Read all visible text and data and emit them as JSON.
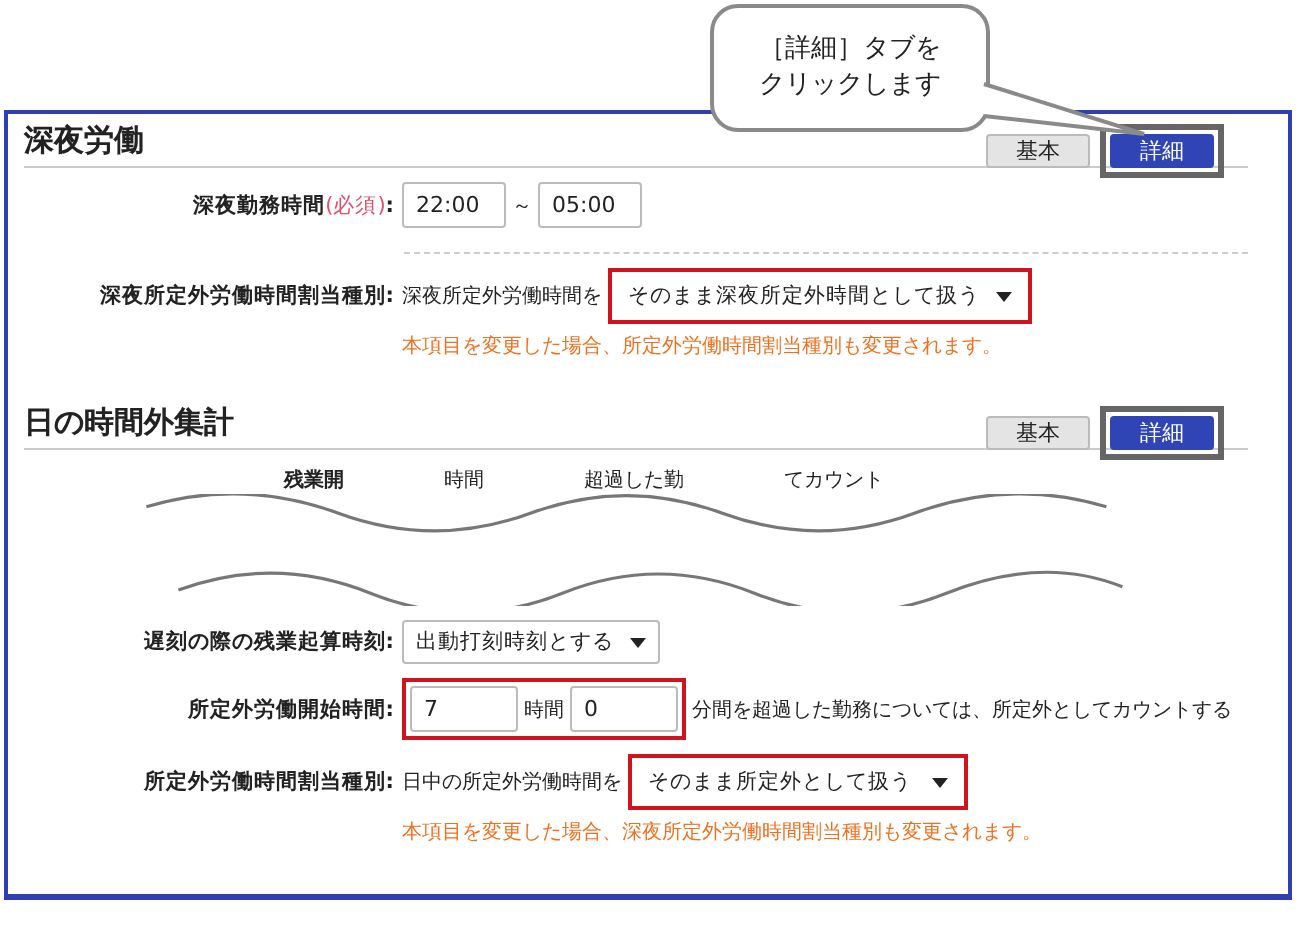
{
  "callout": {
    "lines": [
      "［詳細］タブを",
      "クリックします"
    ]
  },
  "sections": [
    {
      "title": "深夜労働",
      "tabs": [
        {
          "label": "基本",
          "selected": false,
          "highlighted": false
        },
        {
          "label": "詳細",
          "selected": true,
          "highlighted": true
        }
      ],
      "rows": [
        {
          "kind": "time_range",
          "label": "深夜勤務時間",
          "required_mark": "(必須)",
          "label_end": ":",
          "from": "22:00",
          "separator": "～",
          "to": "05:00"
        },
        {
          "kind": "select",
          "label": "深夜所定外労働時間割当種別:",
          "prefix": "深夜所定外労働時間を",
          "value": "そのまま深夜所定外時間として扱う",
          "highlighted": true,
          "note": "本項目を変更した場合、所定外労働時間割当種別も変更されます。"
        }
      ]
    },
    {
      "title": "日の時間外集計",
      "tabs": [
        {
          "label": "基本",
          "selected": false,
          "highlighted": false
        },
        {
          "label": "詳細",
          "selected": true,
          "highlighted": true
        }
      ],
      "torn_row": {
        "label": "残業開",
        "unit": "時間",
        "text_1": "超過した勤",
        "text_2": "てカウント"
      },
      "rows": [
        {
          "kind": "select",
          "label": "遅刻の際の残業起算時刻:",
          "value": "出動打刻時刻とする",
          "highlighted": false
        },
        {
          "kind": "hours",
          "label": "所定外労働開始時間:",
          "hours": "7",
          "hours_unit": "時間",
          "minutes": "0",
          "suffix": "分間を超過した勤務については、所定外としてカウントする",
          "highlighted": true
        },
        {
          "kind": "select",
          "label": "所定外労働時間割当種別:",
          "prefix": "日中の所定外労働時間を",
          "value": "そのまま所定外として扱う",
          "highlighted": true,
          "note": "本項目を変更した場合、深夜所定外労働時間割当種別も変更されます。"
        }
      ]
    }
  ]
}
